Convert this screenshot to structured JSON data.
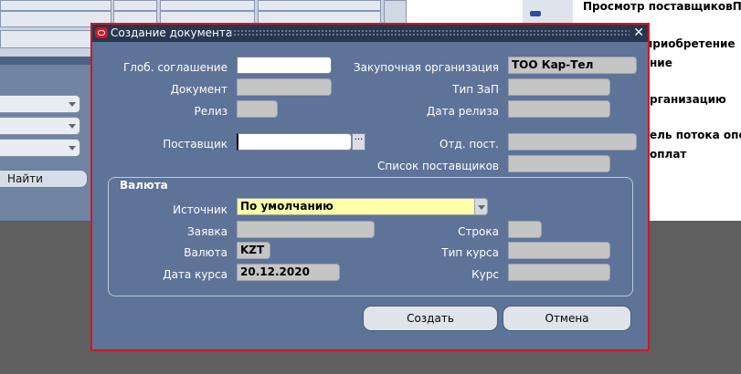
{
  "background": {
    "find_button": "Найти",
    "right_texts": [
      "Просмотр поставщиковПос",
      "приобретение",
      "ние",
      "рганизацию",
      "ель потока опер",
      "оплат"
    ]
  },
  "dialog": {
    "title": "Создание документа",
    "fields": {
      "global_agreement": {
        "label": "Глоб. соглашение",
        "value": ""
      },
      "document": {
        "label": "Документ",
        "value": ""
      },
      "release": {
        "label": "Релиз",
        "value": ""
      },
      "supplier": {
        "label": "Поставщик",
        "value": ""
      },
      "purchasing_org": {
        "label": "Закупочная организация",
        "value": "ТОО Кар-Тел"
      },
      "po_type": {
        "label": "Тип ЗаП",
        "value": ""
      },
      "release_date": {
        "label": "Дата релиза",
        "value": ""
      },
      "supplier_site": {
        "label": "Отд. пост.",
        "value": ""
      },
      "supplier_list": {
        "label": "Список поставщиков",
        "value": ""
      }
    },
    "currency_group": {
      "title": "Валюта",
      "source": {
        "label": "Источник",
        "value": "По умолчанию"
      },
      "requisition": {
        "label": "Заявка",
        "value": ""
      },
      "line": {
        "label": "Строка",
        "value": ""
      },
      "currency": {
        "label": "Валюта",
        "value": "KZT"
      },
      "rate_type": {
        "label": "Тип курса",
        "value": ""
      },
      "rate_date": {
        "label": "Дата курса",
        "value": "20.12.2020"
      },
      "rate": {
        "label": "Курс",
        "value": ""
      }
    },
    "buttons": {
      "create": "Создать",
      "cancel": "Отмена"
    }
  },
  "colors": {
    "dialog_bg": "#5e7398",
    "dialog_border": "#d2161e",
    "title_bar": "#26374f",
    "required_field": "#ffffa8"
  }
}
